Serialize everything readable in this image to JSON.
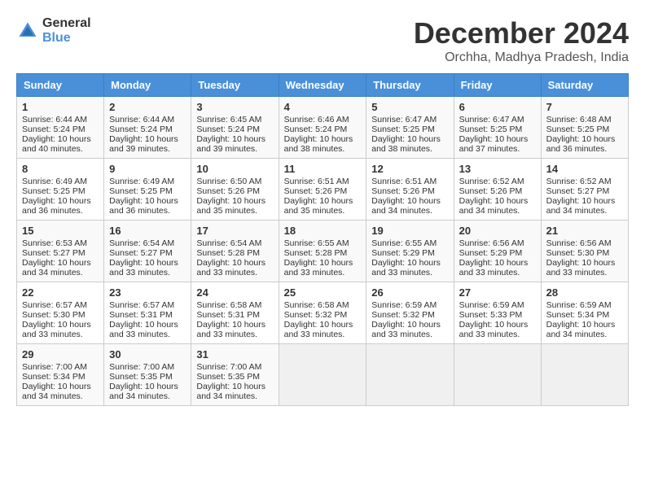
{
  "logo": {
    "general": "General",
    "blue": "Blue"
  },
  "title": {
    "month": "December 2024",
    "location": "Orchha, Madhya Pradesh, India"
  },
  "days_of_week": [
    "Sunday",
    "Monday",
    "Tuesday",
    "Wednesday",
    "Thursday",
    "Friday",
    "Saturday"
  ],
  "weeks": [
    [
      {
        "day": "1",
        "sunrise": "6:44 AM",
        "sunset": "5:24 PM",
        "daylight": "10 hours and 40 minutes."
      },
      {
        "day": "2",
        "sunrise": "6:44 AM",
        "sunset": "5:24 PM",
        "daylight": "10 hours and 39 minutes."
      },
      {
        "day": "3",
        "sunrise": "6:45 AM",
        "sunset": "5:24 PM",
        "daylight": "10 hours and 39 minutes."
      },
      {
        "day": "4",
        "sunrise": "6:46 AM",
        "sunset": "5:24 PM",
        "daylight": "10 hours and 38 minutes."
      },
      {
        "day": "5",
        "sunrise": "6:47 AM",
        "sunset": "5:25 PM",
        "daylight": "10 hours and 38 minutes."
      },
      {
        "day": "6",
        "sunrise": "6:47 AM",
        "sunset": "5:25 PM",
        "daylight": "10 hours and 37 minutes."
      },
      {
        "day": "7",
        "sunrise": "6:48 AM",
        "sunset": "5:25 PM",
        "daylight": "10 hours and 36 minutes."
      }
    ],
    [
      {
        "day": "8",
        "sunrise": "6:49 AM",
        "sunset": "5:25 PM",
        "daylight": "10 hours and 36 minutes."
      },
      {
        "day": "9",
        "sunrise": "6:49 AM",
        "sunset": "5:25 PM",
        "daylight": "10 hours and 36 minutes."
      },
      {
        "day": "10",
        "sunrise": "6:50 AM",
        "sunset": "5:26 PM",
        "daylight": "10 hours and 35 minutes."
      },
      {
        "day": "11",
        "sunrise": "6:51 AM",
        "sunset": "5:26 PM",
        "daylight": "10 hours and 35 minutes."
      },
      {
        "day": "12",
        "sunrise": "6:51 AM",
        "sunset": "5:26 PM",
        "daylight": "10 hours and 34 minutes."
      },
      {
        "day": "13",
        "sunrise": "6:52 AM",
        "sunset": "5:26 PM",
        "daylight": "10 hours and 34 minutes."
      },
      {
        "day": "14",
        "sunrise": "6:52 AM",
        "sunset": "5:27 PM",
        "daylight": "10 hours and 34 minutes."
      }
    ],
    [
      {
        "day": "15",
        "sunrise": "6:53 AM",
        "sunset": "5:27 PM",
        "daylight": "10 hours and 34 minutes."
      },
      {
        "day": "16",
        "sunrise": "6:54 AM",
        "sunset": "5:27 PM",
        "daylight": "10 hours and 33 minutes."
      },
      {
        "day": "17",
        "sunrise": "6:54 AM",
        "sunset": "5:28 PM",
        "daylight": "10 hours and 33 minutes."
      },
      {
        "day": "18",
        "sunrise": "6:55 AM",
        "sunset": "5:28 PM",
        "daylight": "10 hours and 33 minutes."
      },
      {
        "day": "19",
        "sunrise": "6:55 AM",
        "sunset": "5:29 PM",
        "daylight": "10 hours and 33 minutes."
      },
      {
        "day": "20",
        "sunrise": "6:56 AM",
        "sunset": "5:29 PM",
        "daylight": "10 hours and 33 minutes."
      },
      {
        "day": "21",
        "sunrise": "6:56 AM",
        "sunset": "5:30 PM",
        "daylight": "10 hours and 33 minutes."
      }
    ],
    [
      {
        "day": "22",
        "sunrise": "6:57 AM",
        "sunset": "5:30 PM",
        "daylight": "10 hours and 33 minutes."
      },
      {
        "day": "23",
        "sunrise": "6:57 AM",
        "sunset": "5:31 PM",
        "daylight": "10 hours and 33 minutes."
      },
      {
        "day": "24",
        "sunrise": "6:58 AM",
        "sunset": "5:31 PM",
        "daylight": "10 hours and 33 minutes."
      },
      {
        "day": "25",
        "sunrise": "6:58 AM",
        "sunset": "5:32 PM",
        "daylight": "10 hours and 33 minutes."
      },
      {
        "day": "26",
        "sunrise": "6:59 AM",
        "sunset": "5:32 PM",
        "daylight": "10 hours and 33 minutes."
      },
      {
        "day": "27",
        "sunrise": "6:59 AM",
        "sunset": "5:33 PM",
        "daylight": "10 hours and 33 minutes."
      },
      {
        "day": "28",
        "sunrise": "6:59 AM",
        "sunset": "5:34 PM",
        "daylight": "10 hours and 34 minutes."
      }
    ],
    [
      {
        "day": "29",
        "sunrise": "7:00 AM",
        "sunset": "5:34 PM",
        "daylight": "10 hours and 34 minutes."
      },
      {
        "day": "30",
        "sunrise": "7:00 AM",
        "sunset": "5:35 PM",
        "daylight": "10 hours and 34 minutes."
      },
      {
        "day": "31",
        "sunrise": "7:00 AM",
        "sunset": "5:35 PM",
        "daylight": "10 hours and 34 minutes."
      },
      null,
      null,
      null,
      null
    ]
  ]
}
